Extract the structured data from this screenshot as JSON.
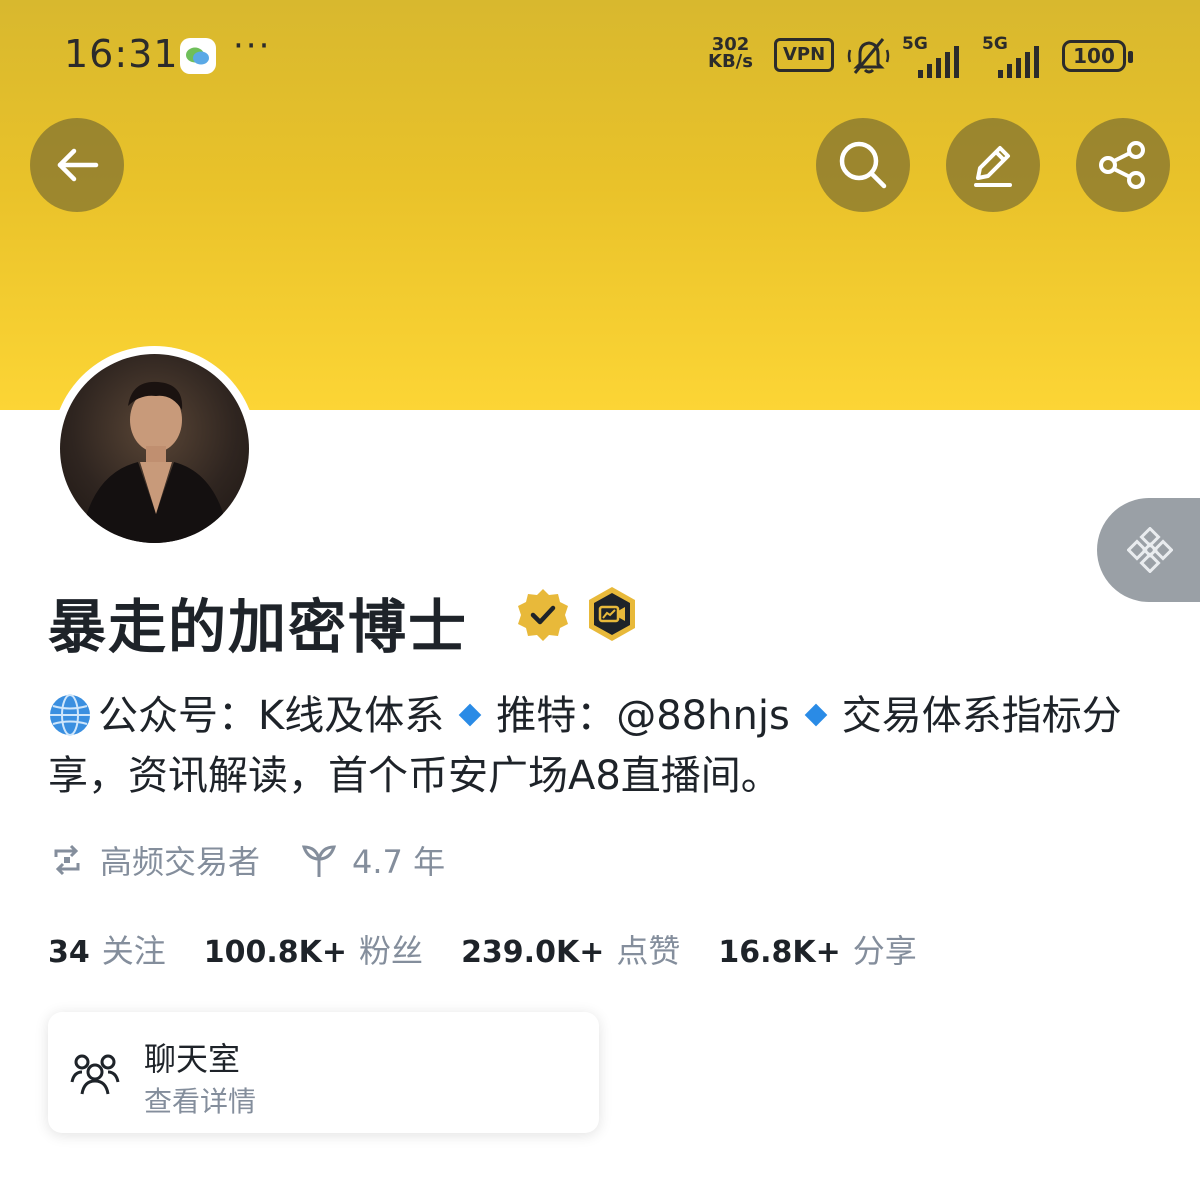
{
  "status_bar": {
    "time": "16:31",
    "speed_value": "302",
    "speed_unit": "KB/s",
    "vpn": "VPN",
    "signal_1": "5G",
    "signal_2": "5G",
    "battery": "100",
    "wechat_icon": "wechat-icon",
    "more_icon": "ellipsis"
  },
  "toolbar": {
    "back_icon": "arrow-left",
    "search_icon": "magnifier",
    "edit_icon": "pencil",
    "share_icon": "share-nodes"
  },
  "profile": {
    "name": "暴走的加密博士",
    "bio_part1": "公众号：K线及体系",
    "bio_part2": "推特：@88hnjs",
    "bio_part3": "交易体系指标分享，资讯解读，首个币安广场A8直播间。",
    "trader_type": "高频交易者",
    "tenure": "4.7 年"
  },
  "stats": [
    {
      "value": "34",
      "label": "关注"
    },
    {
      "value": "100.8K+",
      "label": "粉丝"
    },
    {
      "value": "239.0K+",
      "label": "点赞"
    },
    {
      "value": "16.8K+",
      "label": "分享"
    }
  ],
  "chat_room": {
    "title": "聊天室",
    "subtitle": "查看详情"
  },
  "colors": {
    "banner_top": "#d8b82e",
    "banner_bottom": "#fcd535",
    "diamond": "#2a8be6",
    "muted_text": "#848e9c"
  }
}
